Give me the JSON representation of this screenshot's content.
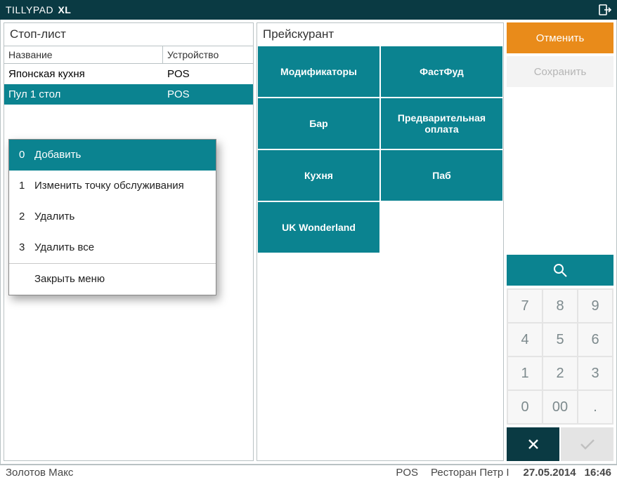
{
  "titlebar": {
    "brand_prefix": "TILLYPAD",
    "brand_suffix": "XL"
  },
  "left": {
    "title": "Стоп-лист",
    "columns": {
      "name": "Название",
      "device": "Устройство"
    },
    "rows": [
      {
        "name": "Японская кухня",
        "device": "POS",
        "selected": false
      },
      {
        "name": "Пул 1 стол",
        "device": "POS",
        "selected": true
      }
    ]
  },
  "context_menu": {
    "items": [
      {
        "idx": "0",
        "label": "Добавить",
        "highlight": true
      },
      {
        "idx": "1",
        "label": "Изменить точку обслуживания"
      },
      {
        "idx": "2",
        "label": "Удалить"
      },
      {
        "idx": "3",
        "label": "Удалить все"
      }
    ],
    "close_label": "Закрыть меню"
  },
  "middle": {
    "title": "Прейскурант",
    "tiles": [
      "Модификаторы",
      "ФастФуд",
      "Бар",
      "Предварительная оплата",
      "Кухня",
      "Паб",
      "UK Wonderland"
    ]
  },
  "right": {
    "cancel": "Отменить",
    "save": "Сохранить",
    "keypad": [
      "7",
      "8",
      "9",
      "4",
      "5",
      "6",
      "1",
      "2",
      "3",
      "0",
      "00",
      "."
    ]
  },
  "statusbar": {
    "user": "Золотов Макс",
    "device": "POS",
    "location": "Ресторан Петр I",
    "date": "27.05.2014",
    "time": "16:46"
  }
}
